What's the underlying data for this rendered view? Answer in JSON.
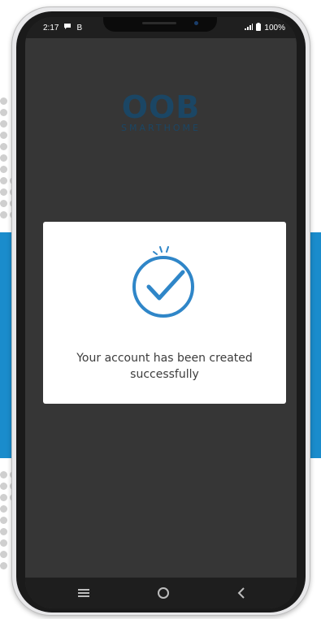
{
  "status_bar": {
    "time": "2:17",
    "notification_letter": "B",
    "battery": "100%"
  },
  "logo": {
    "main": "OOB",
    "sub": "SMARTHOME"
  },
  "dialog": {
    "message": "Your account has been created successfully"
  },
  "colors": {
    "accent_blue": "#1a8ccc",
    "check_blue": "#2f86c8",
    "logo_blue": "#1b4664"
  },
  "nav_icons": [
    "menu-icon",
    "home-circle-icon",
    "back-icon"
  ]
}
